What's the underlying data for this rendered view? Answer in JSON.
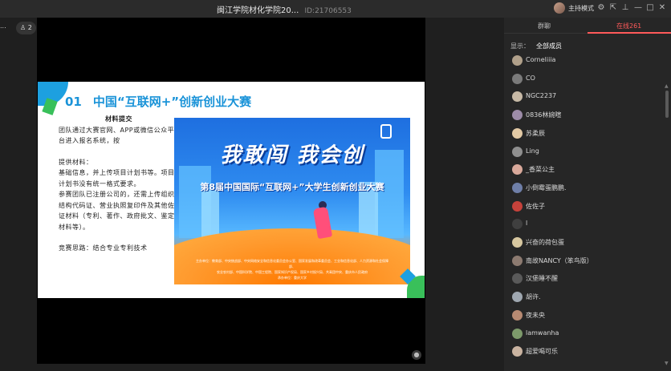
{
  "window": {
    "title": "闽江学院材化学院20...",
    "meeting_id": "ID:21706553",
    "host_mode": "主持模式"
  },
  "left_controls": {
    "label": "...",
    "viewer_count": "2"
  },
  "slide": {
    "number": "01",
    "heading": "中国“互联网+”创新创业大赛",
    "section_title": "材料提交",
    "para1": "团队通过大赛官网、APP或微信公众平台进入报名系统，按",
    "materials_title": "提供材料：",
    "materials_body": "基础信息，并上传项目计划书等。项目计划书没有统一格式要求。",
    "registered_body": "参赛团队已注册公司的，还需上传组织结构代码证、营业执照复印件及其他佐证材料（专利、著作、政府批文、鉴定材料等）。",
    "thinking": "竞赛思路：结合专业专利技术"
  },
  "poster": {
    "big_text": "我敢闯 我会创",
    "sub_text": "第8届中国国际“互联网+”大学生创新创业大赛",
    "footer_line1": "主办单位：教育部、中央统战部、中央网络安全和信息化委员会办公室、国家发展和改革委员会、工业和信息化部、人力资源和社会保障部、",
    "footer_line2": "农业农村部、中国科学院、中国工程院、国家知识产权局、国家乡村振兴局、共青团中央、重庆市人民政府",
    "footer_line3": "承办单位：重庆大学"
  },
  "panel": {
    "tab_chat": "群聊",
    "tab_online": "在线261",
    "filter_label": "显示：",
    "filter_value": "全部成员",
    "members": [
      {
        "name": "Corneliiia",
        "color": "#b0a08a"
      },
      {
        "name": "CO",
        "color": "#7a7a7a"
      },
      {
        "name": "NGC2237",
        "color": "#c7b9a6"
      },
      {
        "name": "0836林婉暄",
        "color": "#9d8ca8"
      },
      {
        "name": "苏柔辰",
        "color": "#e2c9a5"
      },
      {
        "name": "Ling",
        "color": "#8f8f8f"
      },
      {
        "name": "_香菜公主",
        "color": "#d9a99b"
      },
      {
        "name": "小倒霉蛋鹏鹏.",
        "color": "#6f7fa8"
      },
      {
        "name": "佐佐子",
        "color": "#c6423b"
      },
      {
        "name": "l",
        "color": "#3f3f3f"
      },
      {
        "name": "兴奋的荷包蛋",
        "color": "#d7c7a0"
      },
      {
        "name": "南故NANCY（笨鸟版）",
        "color": "#8c7a70"
      },
      {
        "name": "汉堡睡不醒",
        "color": "#5a5a5a"
      },
      {
        "name": "胡许.",
        "color": "#9fa7b0"
      },
      {
        "name": "夜未央",
        "color": "#b78a72"
      },
      {
        "name": "lamwanha",
        "color": "#7d9a6b"
      },
      {
        "name": "超爱喝可乐",
        "color": "#c9b3a0"
      }
    ]
  }
}
